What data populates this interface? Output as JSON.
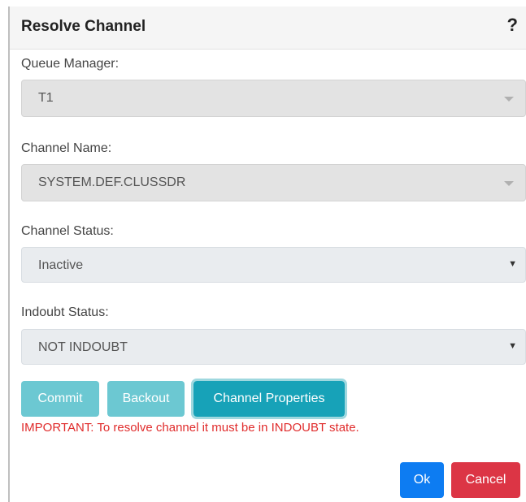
{
  "dialog": {
    "title": "Resolve Channel",
    "help_icon_text": "?"
  },
  "fields": {
    "queue_manager": {
      "label": "Queue Manager:",
      "value": "T1"
    },
    "channel_name": {
      "label": "Channel Name:",
      "value": "SYSTEM.DEF.CLUSSDR"
    },
    "channel_status": {
      "label": "Channel Status:",
      "value": "Inactive"
    },
    "indoubt_status": {
      "label": "Indoubt Status:",
      "value": "NOT INDOUBT"
    }
  },
  "buttons": {
    "commit": "Commit",
    "backout": "Backout",
    "channel_properties": "Channel Properties",
    "ok": "Ok",
    "cancel": "Cancel"
  },
  "message": {
    "important": "IMPORTANT: To resolve channel it must be in INDOUBT state."
  },
  "icons": {
    "dropdown_caret_small": "▼"
  },
  "colors": {
    "primary": "#0d7cf2",
    "info": "#17a2b8",
    "danger": "#dc3545",
    "warning_text": "#e02b2b"
  }
}
